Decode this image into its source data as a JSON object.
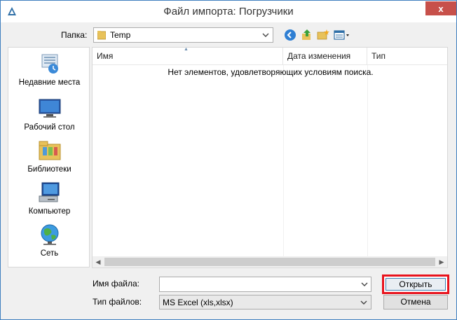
{
  "window": {
    "title": "Файл импорта: Погрузчики",
    "close_label": "x",
    "accent_color": "#c7504a"
  },
  "folder": {
    "label": "Папка:",
    "value": "Temp"
  },
  "toolbar": {
    "icons": [
      "back-icon",
      "up-folder-icon",
      "new-folder-icon",
      "view-menu-icon"
    ]
  },
  "places": [
    {
      "label": "Недавние места",
      "icon": "recent-places-icon"
    },
    {
      "label": "Рабочий стол",
      "icon": "desktop-icon"
    },
    {
      "label": "Библиотеки",
      "icon": "libraries-icon"
    },
    {
      "label": "Компьютер",
      "icon": "computer-icon"
    },
    {
      "label": "Сеть",
      "icon": "network-icon"
    }
  ],
  "filelist": {
    "columns": [
      "Имя",
      "Дата изменения",
      "Тип"
    ],
    "empty_message": "Нет элементов, удовлетворяющих условиям поиска."
  },
  "form": {
    "filename_label": "Имя файла:",
    "filename_value": "",
    "filetype_label": "Тип файлов:",
    "filetype_value": "MS Excel (xls,xlsx)"
  },
  "buttons": {
    "open_label": "Открыть",
    "cancel_label": "Отмена",
    "highlight_color": "#e8131d"
  }
}
